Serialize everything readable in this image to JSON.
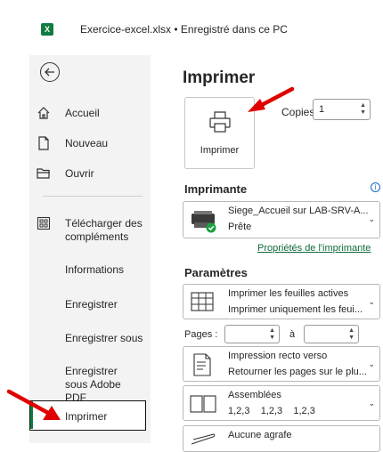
{
  "titlebar": {
    "app_icon": "excel-icon",
    "title": "Exercice-excel.xlsx • Enregistré dans ce PC"
  },
  "sidebar": {
    "back_icon": "back-arrow-icon",
    "items": [
      {
        "label": "Accueil",
        "icon": "home-icon"
      },
      {
        "label": "Nouveau",
        "icon": "new-document-icon"
      },
      {
        "label": "Ouvrir",
        "icon": "folder-icon"
      },
      {
        "label": "Télécharger des compléments",
        "icon": "addins-icon"
      },
      {
        "label": "Informations"
      },
      {
        "label": "Enregistrer"
      },
      {
        "label": "Enregistrer sous"
      },
      {
        "label": "Enregistrer sous Adobe PDF"
      },
      {
        "label": "Imprimer",
        "active": true
      }
    ]
  },
  "main": {
    "title": "Imprimer",
    "print_button_label": "Imprimer",
    "copies_label": "Copies :",
    "copies_value": "1",
    "printer_section": "Imprimante",
    "printer": {
      "name": "Siege_Accueil sur LAB-SRV-A...",
      "status": "Prête"
    },
    "printer_properties_link": "Propriétés de l'imprimante",
    "settings_section": "Paramètres",
    "settings": [
      {
        "line1": "Imprimer les feuilles actives",
        "line2": "Imprimer uniquement les feui...",
        "icon": "sheet-grid-icon"
      },
      {
        "line1": "Impression recto verso",
        "line2": "Retourner les pages sur le plu...",
        "icon": "duplex-icon"
      },
      {
        "line1": "Assemblées",
        "line2": "1,2,3    1,2,3    1,2,3",
        "icon": "collate-icon"
      },
      {
        "line1": "Aucune agrafe",
        "line2": "",
        "icon": "staple-icon"
      }
    ],
    "pages_label": "Pages :",
    "pages_to_label": "à"
  },
  "colors": {
    "excel_green": "#107c41",
    "annotation_red": "#e00000",
    "link_color": "#0f6c3c"
  }
}
